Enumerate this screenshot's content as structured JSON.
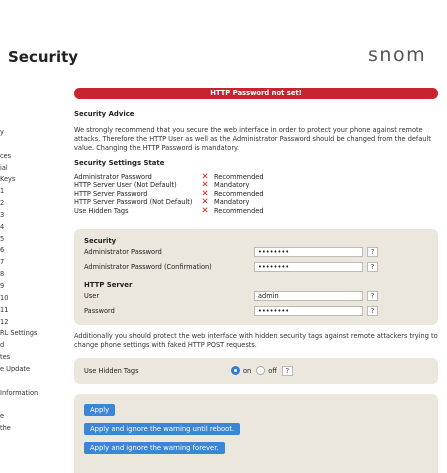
{
  "page": {
    "title": "Security",
    "brand": "snom"
  },
  "sidebar": {
    "items": [
      "y",
      "",
      "ces",
      "ial",
      " Keys",
      "1",
      "2",
      "3",
      "4",
      "5",
      "6",
      "7",
      "8",
      "9",
      "10",
      "11",
      "12",
      "RL Settings",
      "d",
      "tes",
      "e Update",
      "",
      "Information",
      "",
      "e",
      "the"
    ]
  },
  "alert": {
    "text": "HTTP Password not set!"
  },
  "advice": {
    "title": "Security Advice",
    "text": "We strongly recommend that you secure the web interface in order to protect your phone against remote attacks. Therefore the HTTP User as well as the Administrator Password should be changed from the default value. Changing the HTTP Password is mandatory."
  },
  "state": {
    "title": "Security Settings State",
    "rows": [
      {
        "label": "Administrator Password",
        "mark": "✕",
        "value": "Recommended"
      },
      {
        "label": "HTTP Server User (Not Default)",
        "mark": "✕",
        "value": "Mandatory"
      },
      {
        "label": "HTTP Server Password",
        "mark": "✕",
        "value": "Recommended"
      },
      {
        "label": "HTTP Server Password (Not Default)",
        "mark": "✕",
        "value": "Mandatory"
      },
      {
        "label": "Use Hidden Tags",
        "mark": "✕",
        "value": "Recommended"
      }
    ]
  },
  "form": {
    "security_section": "Security",
    "admin_pw_label": "Administrator Password",
    "admin_pw_value": "••••••••",
    "admin_pw_confirm_label": "Administrator Password (Confirmation)",
    "admin_pw_confirm_value": "••••••••",
    "http_section": "HTTP Server",
    "user_label": "User",
    "user_value": "admin",
    "password_label": "Password",
    "password_value": "••••••••",
    "help": "?"
  },
  "hidden_tags": {
    "paragraph": "Additionally you should protect the web interface with hidden security tags against remote attackers trying to change phone settings with faked HTTP POST requests.",
    "label": "Use Hidden Tags",
    "on_label": "on",
    "off_label": "off",
    "selected": "on"
  },
  "buttons": {
    "apply": "Apply",
    "apply_ignore_reboot": "Apply and ignore the warning until reboot.",
    "apply_ignore_forever": "Apply and ignore the warning forever."
  },
  "colors": {
    "alert": "#c8242e",
    "accent": "#3b86d6",
    "panel": "#ebe7dd",
    "error_mark": "#cc2222"
  }
}
